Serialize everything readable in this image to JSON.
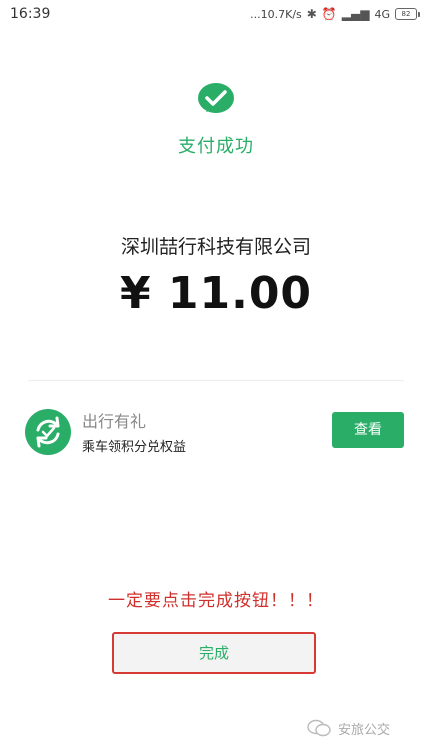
{
  "status_bar": {
    "time": "16:39",
    "network_speed": "...10.7K/s",
    "network_type": "4G",
    "battery": "82"
  },
  "success": {
    "title": "支付成功"
  },
  "payment": {
    "merchant": "深圳喆行科技有限公司",
    "amount": "¥ 11.00"
  },
  "promo": {
    "title": "出行有礼",
    "subtitle": "乘车领积分兑权益",
    "button_label": "查看"
  },
  "warning": "一定要点击完成按钮！！！",
  "done_button": "完成",
  "watermark": "安旅公交",
  "colors": {
    "accent_green": "#2aae67",
    "warning_red": "#d0302c"
  }
}
